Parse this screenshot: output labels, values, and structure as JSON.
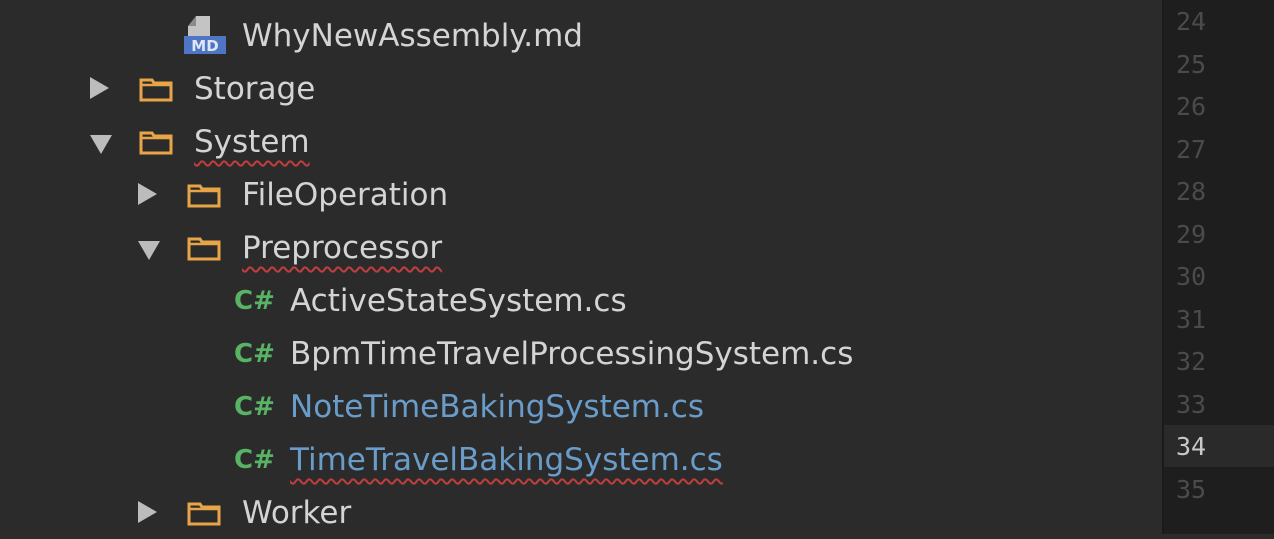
{
  "tree": {
    "items": [
      {
        "label": "WhyNewAssembly.md",
        "icon": "markdown-file-icon",
        "icon_text": "MD"
      },
      {
        "label": "Storage",
        "icon": "folder-icon",
        "expanded": false
      },
      {
        "label": "System",
        "icon": "folder-icon",
        "expanded": true
      },
      {
        "label": "FileOperation",
        "icon": "folder-icon",
        "expanded": false
      },
      {
        "label": "Preprocessor",
        "icon": "folder-icon",
        "expanded": true
      },
      {
        "label": "ActiveStateSystem.cs",
        "icon": "csharp-file-icon",
        "icon_text": "C#"
      },
      {
        "label": "BpmTimeTravelProcessingSystem.cs",
        "icon": "csharp-file-icon",
        "icon_text": "C#"
      },
      {
        "label": "NoteTimeBakingSystem.cs",
        "icon": "csharp-file-icon",
        "icon_text": "C#",
        "vcs_status": "modified"
      },
      {
        "label": "TimeTravelBakingSystem.cs",
        "icon": "csharp-file-icon",
        "icon_text": "C#",
        "vcs_status": "modified"
      },
      {
        "label": "Worker",
        "icon": "folder-icon",
        "expanded": false
      }
    ]
  },
  "gutter": {
    "line_numbers": [
      "24",
      "25",
      "26",
      "27",
      "28",
      "29",
      "30",
      "31",
      "32",
      "33",
      "34",
      "35"
    ],
    "current_line": "34"
  },
  "colors": {
    "background": "#2b2b2b",
    "folder": "#e8a547",
    "csharp": "#58b365",
    "vcs_modified": "#6a9cc9",
    "spell_error": "#c23d3d"
  }
}
